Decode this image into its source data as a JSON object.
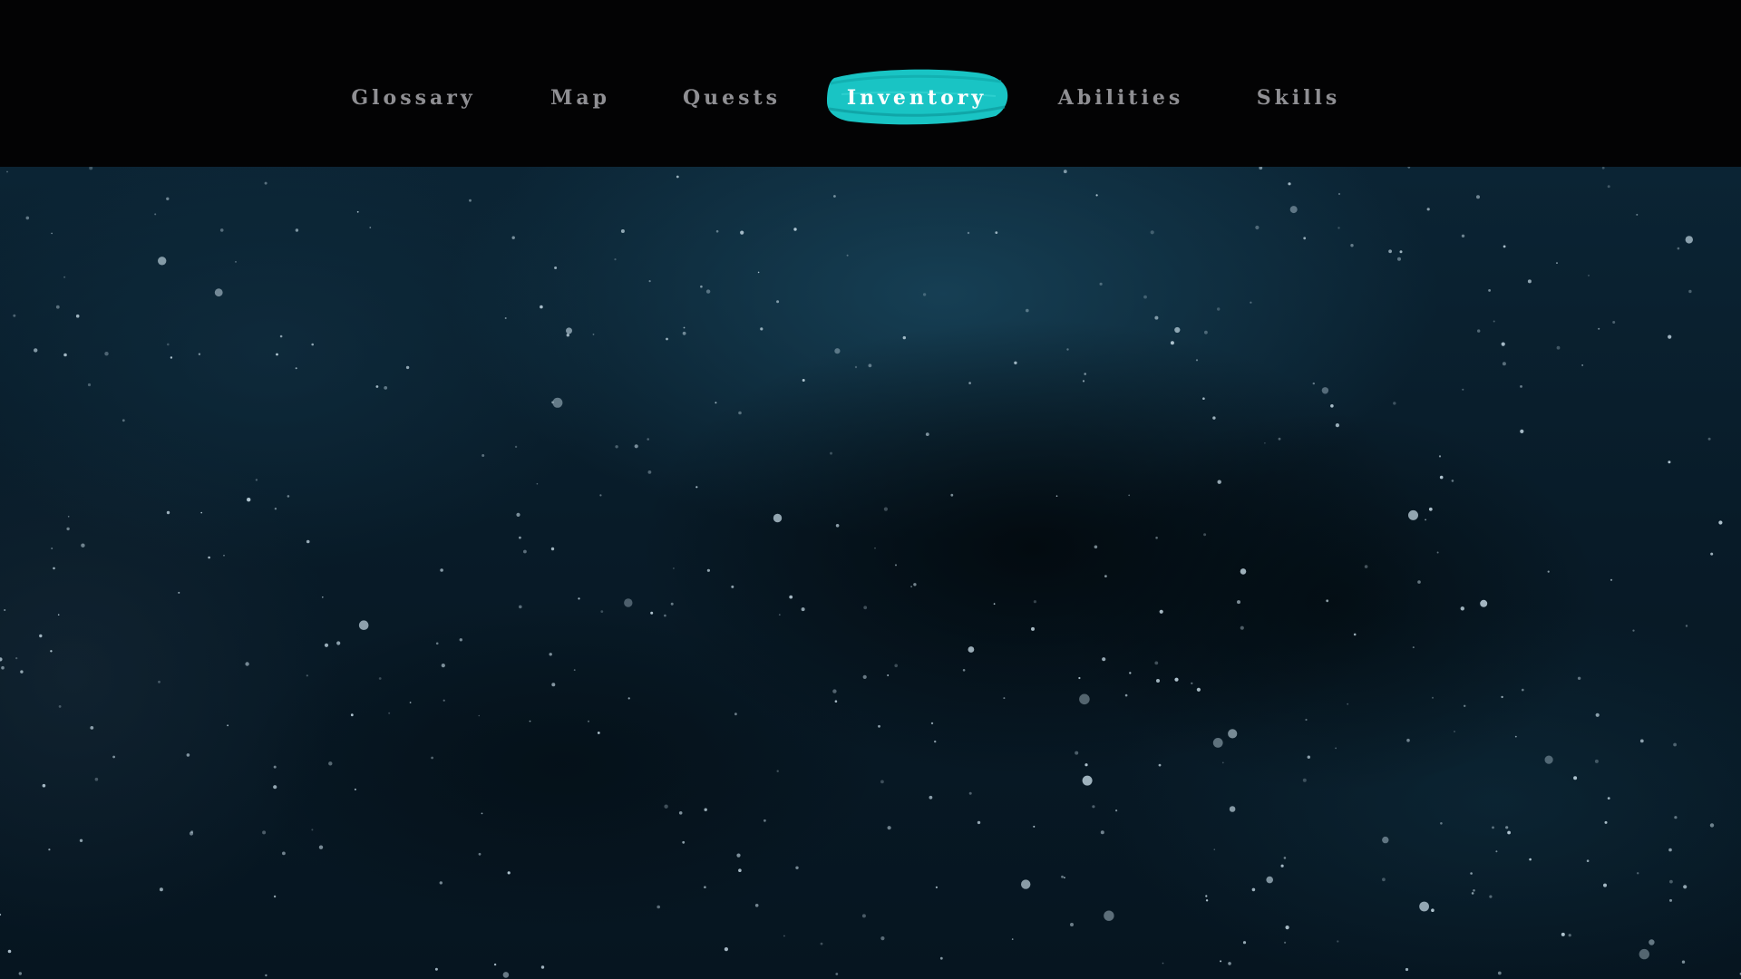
{
  "nav": {
    "tabs": [
      {
        "id": "glossary",
        "label": "Glossary"
      },
      {
        "id": "map",
        "label": "Map"
      },
      {
        "id": "quests",
        "label": "Quests"
      },
      {
        "id": "inventory",
        "label": "Inventory",
        "active": true
      },
      {
        "id": "abilities",
        "label": "Abilities"
      },
      {
        "id": "skills",
        "label": "Skills"
      }
    ]
  },
  "colors": {
    "active_brush": "#19c4c4",
    "inactive_text": "#8f8f93",
    "active_text": "#ffffff",
    "topbar": "#030304",
    "background": "#0b2434"
  }
}
